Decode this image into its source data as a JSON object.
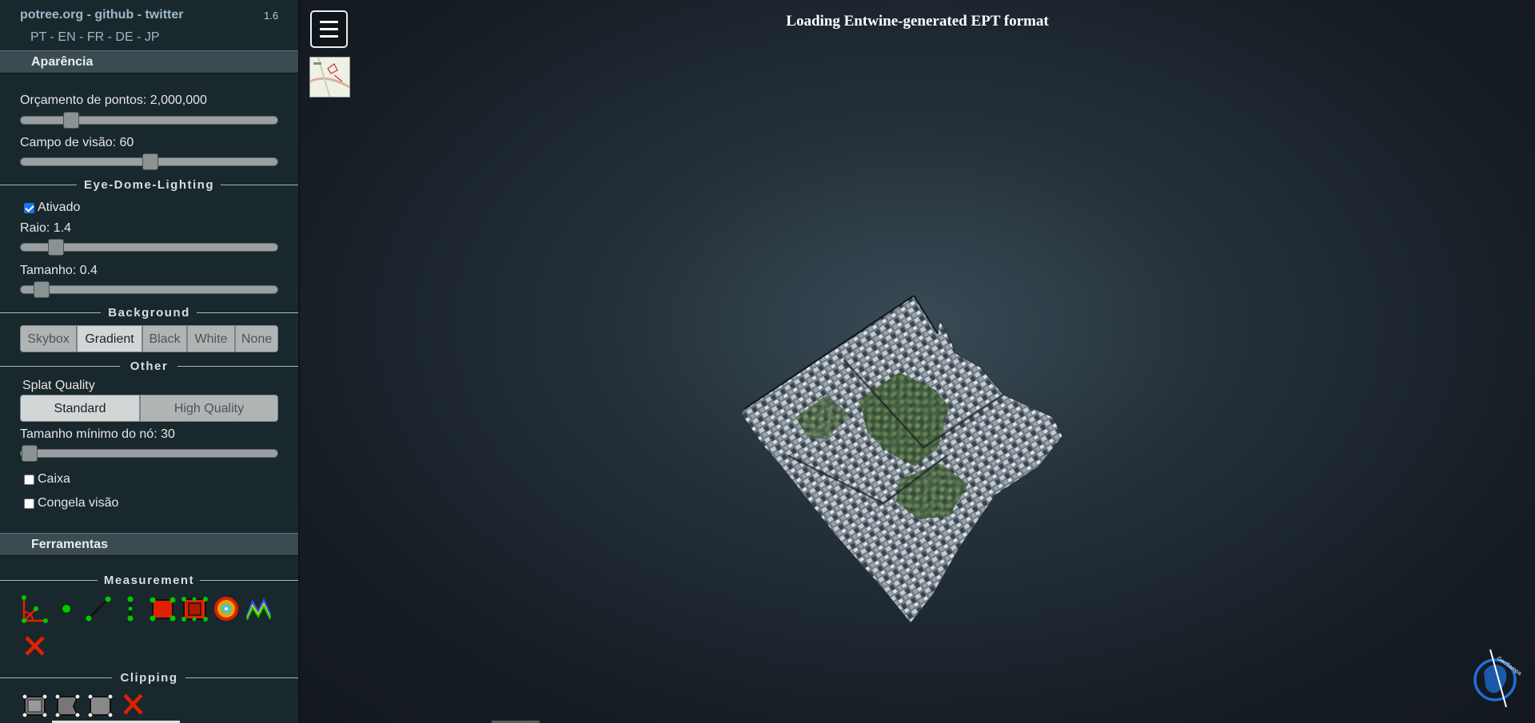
{
  "header": {
    "links": [
      "potree.org",
      "github",
      "twitter"
    ],
    "separator": "-",
    "version": "1.6",
    "languages": [
      "PT",
      "EN",
      "FR",
      "DE",
      "JP"
    ]
  },
  "appearance": {
    "title": "Aparência",
    "point_budget_label": "Orçamento de pontos: 2,000,000",
    "point_budget_value": 2000000,
    "fov_label": "Campo de visão: 60",
    "fov_value": 60
  },
  "edl": {
    "section": "Eye-Dome-Lighting",
    "enabled_label": "Ativado",
    "enabled": true,
    "radius_label": "Raio: 1.4",
    "radius_value": 1.4,
    "strength_label": "Tamanho: 0.4",
    "strength_value": 0.4
  },
  "background": {
    "section": "Background",
    "options": [
      "Skybox",
      "Gradient",
      "Black",
      "White",
      "None"
    ],
    "selected": "Gradient"
  },
  "other": {
    "section": "Other",
    "splat_label": "Splat Quality",
    "splat_options": [
      "Standard",
      "High Quality"
    ],
    "splat_selected": "Standard",
    "min_node_label": "Tamanho mínimo do nó: 30",
    "min_node_value": 30,
    "box_label": "Caixa",
    "box_checked": false,
    "freeze_label": "Congela visão",
    "freeze_checked": false
  },
  "tools": {
    "title": "Ferramentas",
    "measurement_section": "Measurement",
    "measurement_icons": [
      "angle-icon",
      "point-icon",
      "distance-icon",
      "height-icon",
      "circle-icon",
      "area-icon",
      "volume-icon",
      "sphere-volume-icon",
      "profile-icon",
      "remove-all-icon"
    ],
    "clipping_section": "Clipping",
    "clipping_icons": [
      "clip-volume-icon",
      "clip-polygon-icon",
      "clip-screen-box-icon",
      "remove-clipping-icon"
    ]
  },
  "viewer": {
    "title": "Loading Entwine-generated EPT format"
  },
  "colors": {
    "sidebar_bg": "#19282c",
    "accordion_bg": "#3a4c52",
    "link": "#9fb8c8",
    "tool_green": "#00c800",
    "tool_red": "#e02000",
    "logo_blue": "#1f6fd6"
  }
}
